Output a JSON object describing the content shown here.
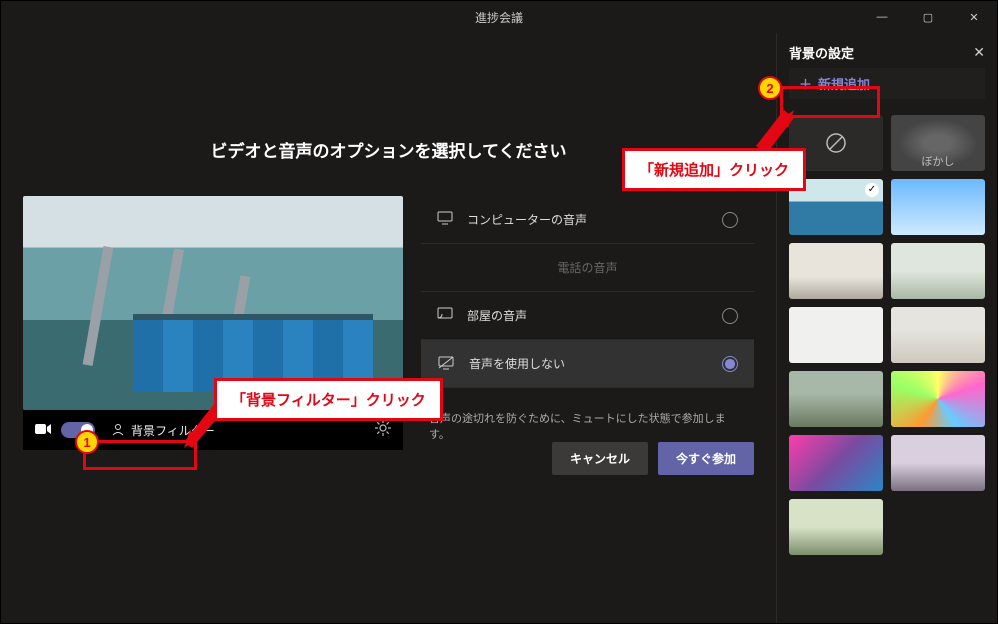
{
  "title": "進捗会議",
  "heading": "ビデオと音声のオプションを選択してください",
  "preview": {
    "bg_filter_label": "背景フィルター"
  },
  "audio": {
    "computer": "コンピューターの音声",
    "phone": "電話の音声",
    "room": "部屋の音声",
    "none": "音声を使用しない",
    "mutenote": "音声の途切れを防ぐために、ミュートにした状態で参加します。"
  },
  "actions": {
    "cancel": "キャンセル",
    "join": "今すぐ参加"
  },
  "sidebar": {
    "title": "背景の設定",
    "add_new": "新規追加",
    "blur_label": "ぼかし"
  },
  "annotations": {
    "filter_click": "「背景フィルター」クリック",
    "add_click": "「新規追加」クリック",
    "num1": "1",
    "num2": "2"
  }
}
